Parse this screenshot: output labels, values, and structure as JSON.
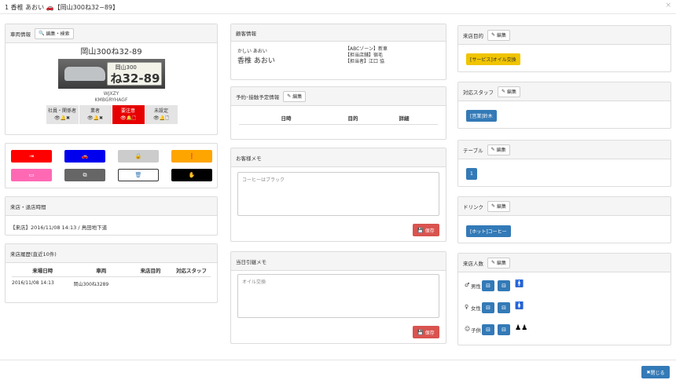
{
  "header": {
    "title": "1  香椎 あおい 🚗【岡山300ね32−89】",
    "close": "×"
  },
  "vehicle": {
    "title": "車両情報",
    "edit_label": "編集・検索",
    "plate_text": "岡山300ね32-89",
    "plate_small": "岡山300",
    "plate_big": "ね32-89",
    "model": "WJXZY",
    "code": "KMBGRYHAGF",
    "contacts": [
      {
        "label": "社員・関係者",
        "icons": "👁🔔✖"
      },
      {
        "label": "業者",
        "icons": "👁🔔✖"
      },
      {
        "label": "要注意",
        "icons": "👁🔔🗋"
      },
      {
        "label": "未設定",
        "icons": "👁🔔🗋"
      }
    ]
  },
  "actions": {
    "colors": [
      "#ff0000",
      "#0000ee",
      "#cccccc",
      "#ffa500",
      "#ff69b4",
      "#666666",
      "#ffffff",
      "#000000"
    ],
    "icons": [
      "⇥",
      "🚗",
      "🔒",
      "❗",
      "▭",
      "⧉",
      "🗑",
      "✋"
    ]
  },
  "visit_time": {
    "title": "来店・退店時間",
    "value": "【来店】2016/11/08 14:13 / 鳥田地下道"
  },
  "history": {
    "title": "来店履歴(直近10件)",
    "columns": [
      "来場日時",
      "車両",
      "来店目的",
      "対応スタッフ"
    ],
    "rows": [
      {
        "date": "2016/11/08 14:13",
        "vehicle": "岡山300ね3289",
        "purpose": "",
        "staff": ""
      }
    ]
  },
  "customer": {
    "title": "顧客情報",
    "kana": "かしい あおい",
    "name": "香椎 あおい",
    "info": [
      "【ABCゾーン】新車",
      "【担当店舗】宿毛",
      "【担当者】江口 協"
    ]
  },
  "reservation": {
    "title": "予約･接触予定情報",
    "edit_label": "編集",
    "columns": [
      "日時",
      "目的",
      "詳細"
    ]
  },
  "memo": {
    "title": "お客様メモ",
    "value": "コーヒーはブラック",
    "save_label": "保存"
  },
  "handover": {
    "title": "当日引継メモ",
    "value": "オイル交換",
    "save_label": "保存"
  },
  "purpose": {
    "title": "来店目的",
    "edit_label": "編集",
    "tag": "[サービス]オイル交換"
  },
  "staff": {
    "title": "対応スタッフ",
    "edit_label": "編集",
    "tag": "[営業]鈴木"
  },
  "table": {
    "title": "テーブル",
    "edit_label": "編集",
    "tag": "1"
  },
  "drink": {
    "title": "ドリンク",
    "edit_label": "編集",
    "tag": "[ホット]コーヒー"
  },
  "visitors": {
    "title": "来店人数",
    "edit_label": "編集",
    "rows": [
      {
        "label": "男性",
        "icon": "♂",
        "color": "#0000ff",
        "figures": "🚹"
      },
      {
        "label": "女性",
        "icon": "♀",
        "color": "#ff0000",
        "figures": "🚺"
      },
      {
        "label": "子供",
        "icon": "☺",
        "color": "#000000",
        "figures": "♟♟"
      }
    ]
  },
  "footer": {
    "close_label": "閉じる"
  }
}
